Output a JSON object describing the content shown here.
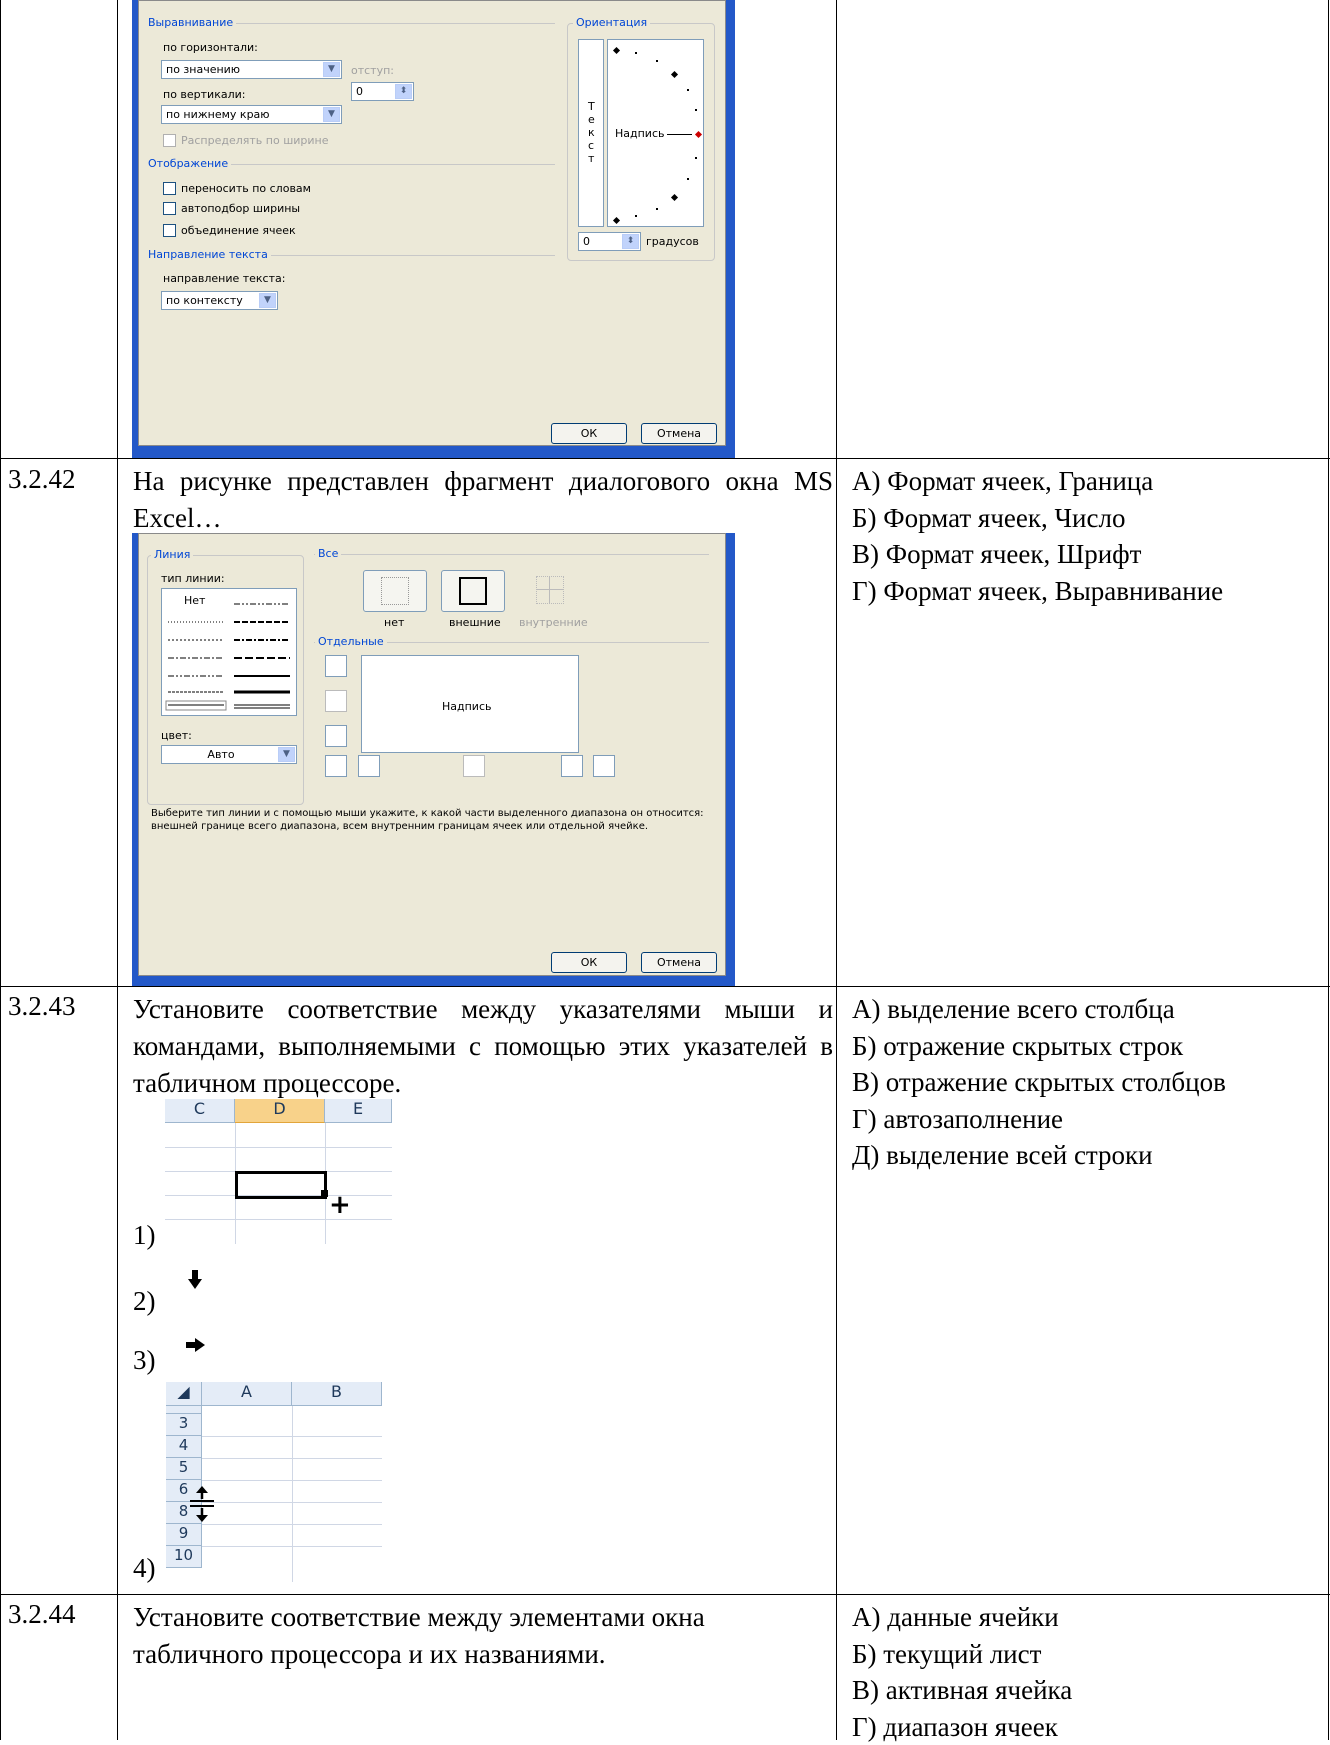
{
  "rows": [
    {
      "number": "",
      "dialog": {
        "alignment_group": "Выравнивание",
        "horizontal_label": "по горизонтали:",
        "horizontal_value": "по значению",
        "indent_label": "отступ:",
        "indent_value": "0",
        "vertical_label": "по вертикали:",
        "vertical_value": "по нижнему краю",
        "distribute_label": "Распределять по ширине",
        "display_group": "Отображение",
        "wrap_label": "переносить по словам",
        "autofit_label": "автоподбор ширины",
        "merge_label": "объединение ячеек",
        "direction_group": "Направление текста",
        "direction_label": "направление текста:",
        "direction_value": "по контексту",
        "orientation_group": "Ориентация",
        "vertical_text": [
          "Т",
          "е",
          "к",
          "с",
          "т"
        ],
        "inscription": "Надпись",
        "degrees_value": "0",
        "degrees_label": "градусов",
        "ok": "ОК",
        "cancel": "Отмена"
      }
    },
    {
      "number": "3.2.42",
      "question": "На рисунке представлен фрагмент диалогового окна MS Excel…",
      "options": [
        "А) Формат ячеек, Граница",
        "Б) Формат ячеек, Число",
        "В) Формат ячеек, Шрифт",
        "Г) Формат ячеек, Выравнивание"
      ],
      "dialog": {
        "line_group": "Линия",
        "line_type_label": "тип линии:",
        "none_style": "Нет",
        "color_label": "цвет:",
        "color_value": "Авто",
        "all_group": "Все",
        "preset_none": "нет",
        "preset_outer": "внешние",
        "preset_inner": "внутренние",
        "separate_group": "Отдельные",
        "inscription": "Надпись",
        "hint": "Выберите тип линии и с помощью мыши укажите, к какой части выделенного диапазона он относится: внешней границе всего диапазона, всем внутренним границам ячеек или отдельной ячейке.",
        "ok": "ОК",
        "cancel": "Отмена"
      }
    },
    {
      "number": "3.2.43",
      "question": "Установите соответствие между указателями мыши и командами, выполняемыми с помощью этих указателей в табличном процессоре.",
      "items": [
        "1)",
        "2)",
        "3)",
        "4)"
      ],
      "sheet1_cols": [
        "C",
        "D",
        "E"
      ],
      "sheet4_cols": [
        "A",
        "B"
      ],
      "sheet4_rows": [
        "3",
        "4",
        "5",
        "6",
        "8",
        "9",
        "10"
      ],
      "options": [
        "А) выделение всего столбца",
        "Б) отражение скрытых строк",
        "В) отражение скрытых столбцов",
        "Г) автозаполнение",
        "Д) выделение всей строки"
      ]
    },
    {
      "number": "3.2.44",
      "question": "Установите соответствие между элементами окна табличного процессора и их названиями.",
      "options": [
        "А) данные ячейки",
        "Б) текущий лист",
        "В) активная ячейка",
        "Г) диапазон ячеек"
      ]
    }
  ]
}
